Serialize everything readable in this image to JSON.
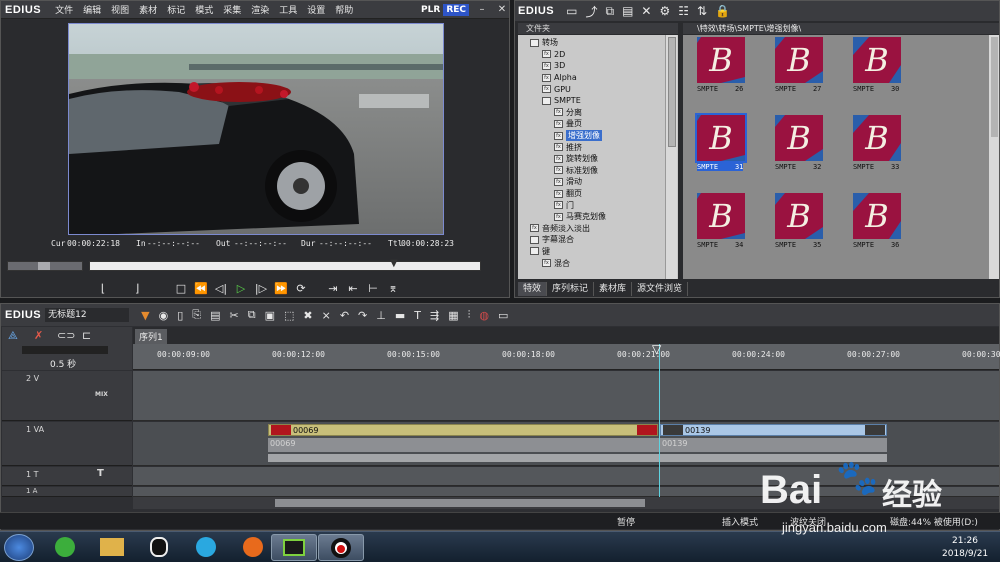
{
  "player": {
    "logo": "EDIUS",
    "menu": [
      "文件",
      "编辑",
      "视图",
      "素材",
      "标记",
      "模式",
      "采集",
      "渲染",
      "工具",
      "设置",
      "帮助"
    ],
    "plr": "PLR",
    "rec": "REC",
    "timecodes": {
      "cur_label": "Cur",
      "cur": "00:00:22:18",
      "in_label": "In",
      "in": "--:--:--:--",
      "out_label": "Out",
      "out": "--:--:--:--",
      "dur_label": "Dur",
      "dur": "--:--:--:--",
      "ttl_label": "Ttl",
      "ttl": "00:00:28:23"
    }
  },
  "bin": {
    "logo": "EDIUS",
    "folder_header": "文件夹",
    "path": "\\特效\\转场\\SMPTE\\增强划像\\",
    "tree": [
      {
        "label": "转场",
        "indent": 1,
        "icon": "folder"
      },
      {
        "label": "2D",
        "indent": 2,
        "icon": "fx"
      },
      {
        "label": "3D",
        "indent": 2,
        "icon": "fx"
      },
      {
        "label": "Alpha",
        "indent": 2,
        "icon": "fx"
      },
      {
        "label": "GPU",
        "indent": 2,
        "icon": "fx"
      },
      {
        "label": "SMPTE",
        "indent": 2,
        "icon": "folder"
      },
      {
        "label": "分离",
        "indent": 3,
        "icon": "fx"
      },
      {
        "label": "叠页",
        "indent": 3,
        "icon": "fx"
      },
      {
        "label": "增强划像",
        "indent": 3,
        "icon": "fx",
        "selected": true
      },
      {
        "label": "推挤",
        "indent": 3,
        "icon": "fx"
      },
      {
        "label": "旋转划像",
        "indent": 3,
        "icon": "fx"
      },
      {
        "label": "标准划像",
        "indent": 3,
        "icon": "fx"
      },
      {
        "label": "滑动",
        "indent": 3,
        "icon": "fx"
      },
      {
        "label": "翻页",
        "indent": 3,
        "icon": "fx"
      },
      {
        "label": "门",
        "indent": 3,
        "icon": "fx"
      },
      {
        "label": "马赛克划像",
        "indent": 3,
        "icon": "fx"
      },
      {
        "label": "音频淡入淡出",
        "indent": 1,
        "icon": "fx"
      },
      {
        "label": "字幕混合",
        "indent": 1,
        "icon": "folder"
      },
      {
        "label": "键",
        "indent": 1,
        "icon": "folder"
      },
      {
        "label": "混合",
        "indent": 2,
        "icon": "fx"
      }
    ],
    "thumbs": [
      {
        "name": "SMPTE",
        "num": "26"
      },
      {
        "name": "SMPTE",
        "num": "27"
      },
      {
        "name": "SMPTE",
        "num": "30"
      },
      {
        "name": "SMPTE",
        "num": "31",
        "selected": true
      },
      {
        "name": "SMPTE",
        "num": "32"
      },
      {
        "name": "SMPTE",
        "num": "33"
      },
      {
        "name": "SMPTE",
        "num": "34"
      },
      {
        "name": "SMPTE",
        "num": "35"
      },
      {
        "name": "SMPTE",
        "num": "36"
      }
    ],
    "thumb_letter": "B",
    "tabs": [
      "特效",
      "序列标记",
      "素材库",
      "源文件浏览"
    ]
  },
  "timeline": {
    "logo": "EDIUS",
    "project": "无标题12",
    "sequence_tab": "序列1",
    "zoom": "0.5 秒",
    "ruler": [
      "00:00:09:00",
      "00:00:12:00",
      "00:00:15:00",
      "00:00:18:00",
      "00:00:21:00",
      "00:00:24:00",
      "00:00:27:00",
      "00:00:30:00"
    ],
    "tracks": {
      "v2": "2 V",
      "mix": "MIX",
      "va1": "1 VA",
      "t1": "1 T",
      "a1": "1 A"
    },
    "clips": [
      {
        "name": "00069",
        "sub": "00069"
      },
      {
        "name": "00139",
        "sub": "00139"
      }
    ]
  },
  "status": {
    "pause": "暂停",
    "insert_mode": "插入模式",
    "ripple": "波纹关闭",
    "disk": "磁盘:44% 被使用(D:)"
  },
  "taskbar": {
    "time": "21:26",
    "date": "2018/9/21"
  },
  "watermark": {
    "brand": "Bai",
    "brand2": "经验",
    "url": "jingyan.baidu.com"
  },
  "colors": {
    "rec": "#2e55c8",
    "clip_yellow": "#c8bf7a",
    "clip_blue": "#aac7e6",
    "thumb_bg": "#2a5eab",
    "thumb_red": "#9a1240",
    "selection": "#3a6ecc"
  }
}
